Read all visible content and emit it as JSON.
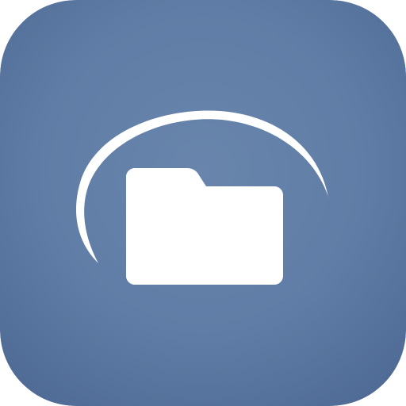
{
  "app_icon": {
    "name": "folder-app-icon",
    "colors": {
      "background_top": "#5f7da6",
      "background_bottom": "#4e6a94",
      "background_highlight": "#6985ac",
      "foreground": "#ffffff"
    },
    "icons": {
      "primary": "folder-icon",
      "decorative": "orbit-arc-icon"
    }
  }
}
